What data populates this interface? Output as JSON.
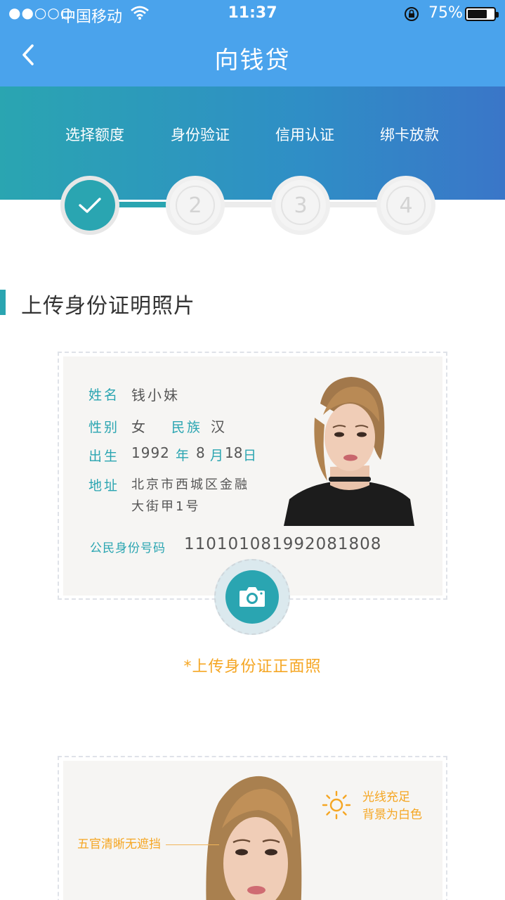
{
  "status_bar": {
    "signal": "●●○○○",
    "carrier": "中国移动",
    "time": "11:37",
    "battery_percent": "75%",
    "battery_level": 0.75
  },
  "nav": {
    "title": "向钱贷"
  },
  "steps": {
    "items": [
      {
        "label": "选择额度",
        "number": "",
        "done": true
      },
      {
        "label": "身份验证",
        "number": "2",
        "done": false
      },
      {
        "label": "信用认证",
        "number": "3",
        "done": false
      },
      {
        "label": "绑卡放款",
        "number": "4",
        "done": false
      }
    ]
  },
  "section": {
    "title": "上传身份证明照片"
  },
  "id_card": {
    "name_label": "姓名",
    "name_value": "钱小妹",
    "gender_label": "性别",
    "gender_value": "女",
    "ethnicity_label": "民族",
    "ethnicity_value": "汉",
    "birth_label": "出生",
    "birth_year": "1992",
    "birth_year_unit": "年",
    "birth_month": "8",
    "birth_month_unit": "月",
    "birth_day": "18",
    "birth_day_unit": "日",
    "address_label": "地址",
    "address_line1": "北京市西城区金融",
    "address_line2": "大街甲1号",
    "id_label": "公民身份号码",
    "id_number": "110101081992081808"
  },
  "upload": {
    "note": "*上传身份证正面照"
  },
  "face_card": {
    "tip_features": "五官清晰无遮挡",
    "tip_light_line1": "光线充足",
    "tip_light_line2": "背景为白色"
  },
  "colors": {
    "nav_blue": "#4aa3ec",
    "teal": "#2aa5b1",
    "accent_orange": "#f5a623"
  }
}
